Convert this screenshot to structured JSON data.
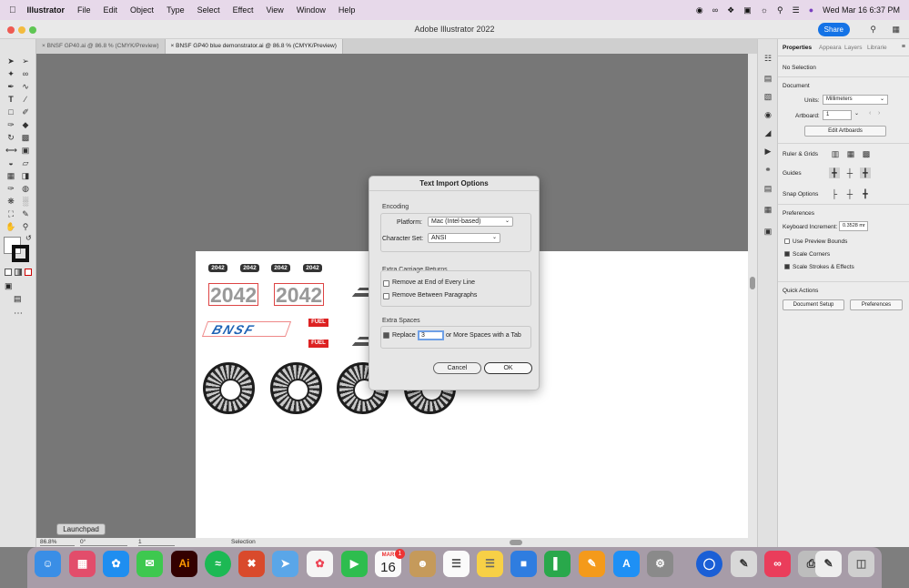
{
  "menubar": {
    "app_name": "Illustrator",
    "items": [
      "File",
      "Edit",
      "Object",
      "Type",
      "Select",
      "Effect",
      "View",
      "Window",
      "Help"
    ],
    "clock": "Wed Mar 16  6:37 PM"
  },
  "window": {
    "title": "Adobe Illustrator 2022",
    "share_label": "Share"
  },
  "tabs": [
    {
      "label": "BNSF GP40.ai @ 86.8 % (CMYK/Preview)"
    },
    {
      "label": "BNSF GP40 blue demonstrator.ai @ 86.8 % (CMYK/Preview)"
    }
  ],
  "artwork": {
    "small_numbers": [
      "2042",
      "2042",
      "2042",
      "2042"
    ],
    "big_numbers": [
      "2042",
      "2042"
    ],
    "logo": "BNSF",
    "fuel_labels": [
      "FUEL",
      "FUEL"
    ]
  },
  "dialog": {
    "title": "Text Import Options",
    "encoding": {
      "label": "Encoding",
      "platform_label": "Platform:",
      "platform_value": "Mac (Intel-based)",
      "charset_label": "Character Set:",
      "charset_value": "ANSI"
    },
    "carriage": {
      "label": "Extra Carriage Returns",
      "opt1": "Remove at End of Every Line",
      "opt2": "Remove Between Paragraphs"
    },
    "spaces": {
      "label": "Extra Spaces",
      "replace_label": "Replace",
      "replace_value": "3",
      "suffix": "or More Spaces with a Tab"
    },
    "cancel_label": "Cancel",
    "ok_label": "OK"
  },
  "panel": {
    "tabs": [
      "Properties",
      "Appeara",
      "Layers",
      "Librarie"
    ],
    "no_selection": "No Selection",
    "document": "Document",
    "units_label": "Units:",
    "units_value": "Millimeters",
    "artboard_label": "Artboard:",
    "artboard_value": "1",
    "edit_artboards": "Edit Artboards",
    "ruler_grids": "Ruler & Grids",
    "guides": "Guides",
    "snap_options": "Snap Options",
    "preferences_header": "Preferences",
    "keyboard_increment_label": "Keyboard Increment:",
    "keyboard_increment_value": "0.3528 mr",
    "use_preview_bounds": "Use Preview Bounds",
    "scale_corners": "Scale Corners",
    "scale_strokes": "Scale Strokes & Effects",
    "quick_actions": "Quick Actions",
    "document_setup": "Document Setup",
    "preferences_button": "Preferences"
  },
  "status": {
    "zoom": "86.8%",
    "rotation": "0°",
    "artboard": "1",
    "tool": "Selection"
  },
  "launchpad_tooltip": "Launchpad",
  "dock": {
    "calendar_month": "MAR",
    "calendar_day": "16",
    "ai_label": "Ai",
    "badge": "1"
  },
  "colors": {
    "accent": "#1473e6",
    "menubar_bg": "#e7d9ea",
    "fuel_red": "#d22222",
    "bnsf_blue": "#1f63b5"
  }
}
